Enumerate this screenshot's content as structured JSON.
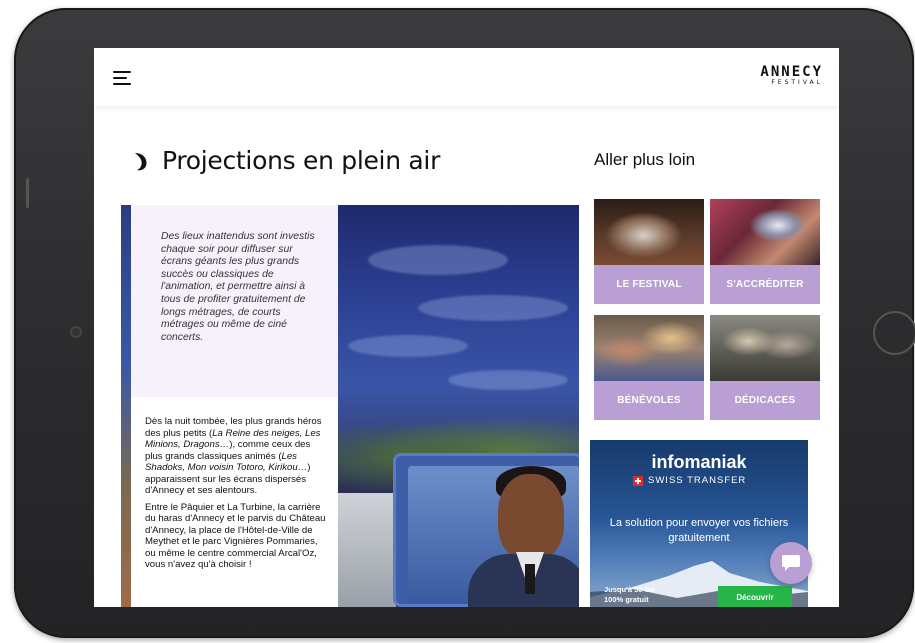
{
  "device": {
    "type": "tablet"
  },
  "header": {
    "menu_icon": "hamburger-menu-icon",
    "logo_line1": "ANNECY",
    "logo_line2": "FESTIVAL"
  },
  "page": {
    "title": "Projections en plein air",
    "title_icon": "swirl-icon"
  },
  "article": {
    "intro_quote": "Des lieux inattendus sont investis chaque soir pour diffuser sur écrans géants les plus grands succès ou classiques de l'animation, et permettre ainsi à tous de profiter gratuitement de longs métrages, de courts métrages ou même de ciné concerts.",
    "para1_a": "Dès la nuit tombée, les plus grands héros des plus petits (",
    "para1_b": "La Reine des neiges, Les Minions, Dragons…",
    "para1_c": "), comme ceux des plus grands classiques animés (",
    "para1_d": "Les Shadoks, Mon voisin Totoro, Kirikou…",
    "para1_e": ") apparaissent sur les écrans dispersés d'Annecy et ses alentours.",
    "para2": "Entre le Pâquier et La Turbine, la carrière du haras d'Annecy et le parvis du Château d'Annecy, la place de l'Hôtel-de-Ville de Meythet et le parc Vignières Pommaries, ou même le centre commercial Arcal'Oz, vous n'avez qu'à choisir !"
  },
  "aside": {
    "title": "Aller plus loin",
    "tiles": [
      {
        "label": "LE FESTIVAL"
      },
      {
        "label": "S'ACCRÉDITER"
      },
      {
        "label": "BÉNÉVOLES"
      },
      {
        "label": "DÉDICACES"
      }
    ]
  },
  "ad": {
    "brand": "infomaniak",
    "product": "SWISS TRANSFER",
    "tagline": "La solution pour envoyer vos fichiers gratuitement",
    "small_line1": "Jusqu'à 50 Go",
    "small_line2": "100% gratuit",
    "button": "Découvrir"
  },
  "chat": {
    "icon": "chat-bubble-icon"
  },
  "colors": {
    "accent": "#b99fd3",
    "quote_bg": "#f6f1fb",
    "ad_button": "#27b54a"
  }
}
